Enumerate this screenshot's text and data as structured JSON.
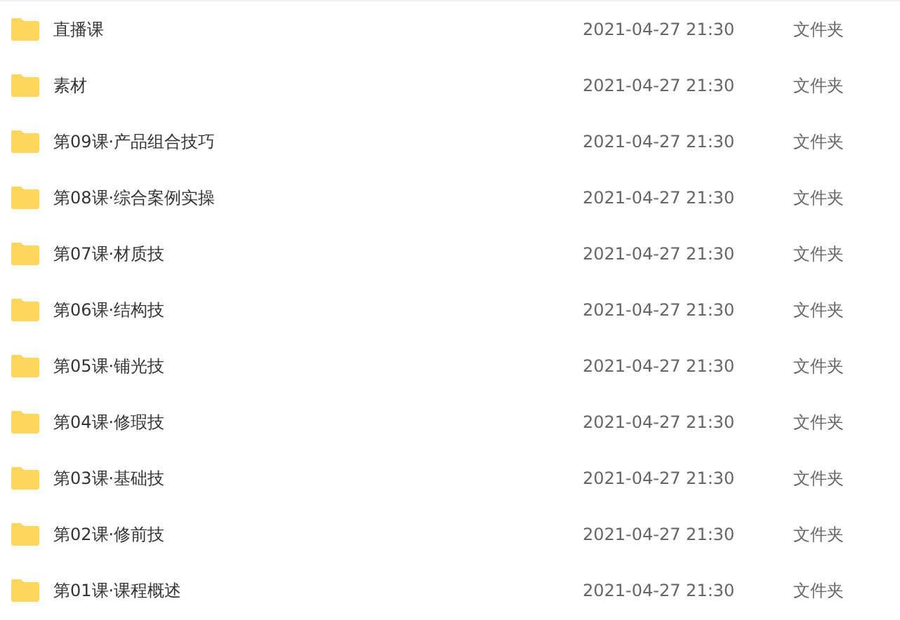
{
  "files": [
    {
      "name": "直播课",
      "modified": "2021-04-27 21:30",
      "type": "文件夹"
    },
    {
      "name": "素材",
      "modified": "2021-04-27 21:30",
      "type": "文件夹"
    },
    {
      "name": "第09课·产品组合技巧",
      "modified": "2021-04-27 21:30",
      "type": "文件夹"
    },
    {
      "name": "第08课·综合案例实操",
      "modified": "2021-04-27 21:30",
      "type": "文件夹"
    },
    {
      "name": "第07课·材质技",
      "modified": "2021-04-27 21:30",
      "type": "文件夹"
    },
    {
      "name": "第06课·结构技",
      "modified": "2021-04-27 21:30",
      "type": "文件夹"
    },
    {
      "name": "第05课·铺光技",
      "modified": "2021-04-27 21:30",
      "type": "文件夹"
    },
    {
      "name": "第04课·修瑕技",
      "modified": "2021-04-27 21:30",
      "type": "文件夹"
    },
    {
      "name": "第03课·基础技",
      "modified": "2021-04-27 21:30",
      "type": "文件夹"
    },
    {
      "name": "第02课·修前技",
      "modified": "2021-04-27 21:30",
      "type": "文件夹"
    },
    {
      "name": "第01课·课程概述",
      "modified": "2021-04-27 21:30",
      "type": "文件夹"
    }
  ]
}
